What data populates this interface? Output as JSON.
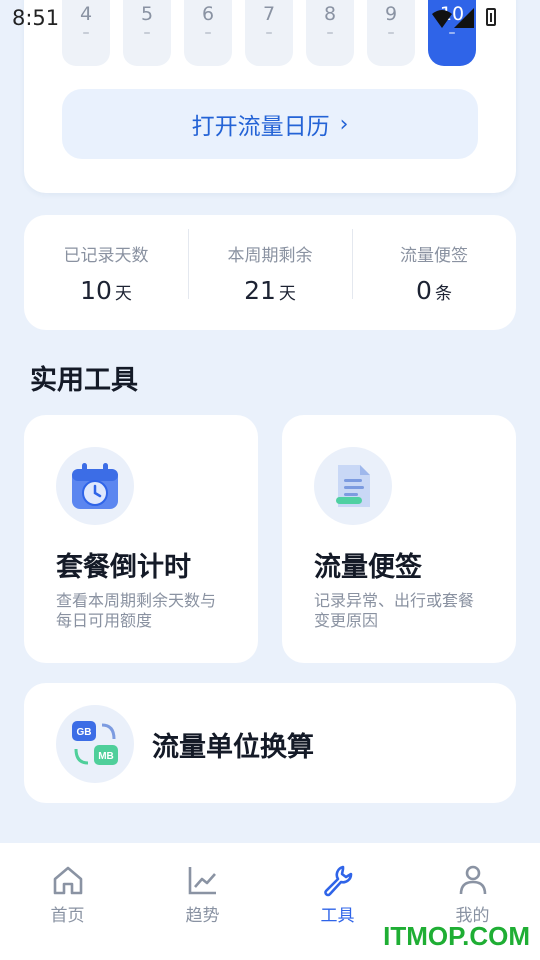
{
  "status_bar": {
    "time": "8:51"
  },
  "calendar": {
    "days": [
      {
        "num": "4",
        "value": "–",
        "active": false
      },
      {
        "num": "5",
        "value": "–",
        "active": false
      },
      {
        "num": "6",
        "value": "–",
        "active": false
      },
      {
        "num": "7",
        "value": "–",
        "active": false
      },
      {
        "num": "8",
        "value": "–",
        "active": false
      },
      {
        "num": "9",
        "value": "–",
        "active": false
      },
      {
        "num": "10",
        "value": "–",
        "active": true
      }
    ],
    "open_label": "打开流量日历",
    "open_chevron": "›"
  },
  "stats": [
    {
      "label": "已记录天数",
      "value": "10",
      "unit": "天"
    },
    {
      "label": "本周期剩余",
      "value": "21",
      "unit": "天"
    },
    {
      "label": "流量便签",
      "value": "0",
      "unit": "条"
    }
  ],
  "section": {
    "title": "实用工具"
  },
  "tools": {
    "countdown": {
      "title": "套餐倒计时",
      "desc": "查看本周期剩余天数与每日可用额度",
      "icon": "calendar-clock-icon"
    },
    "notes": {
      "title": "流量便签",
      "desc": "记录异常、出行或套餐变更原因",
      "icon": "note-icon"
    },
    "converter": {
      "title": "流量单位换算",
      "icon": "gb-mb-convert-icon",
      "badge_gb": "GB",
      "badge_mb": "MB"
    }
  },
  "nav": {
    "items": [
      {
        "label": "首页",
        "icon": "home-icon",
        "active": false
      },
      {
        "label": "趋势",
        "icon": "trend-icon",
        "active": false
      },
      {
        "label": "工具",
        "icon": "wrench-icon",
        "active": true
      },
      {
        "label": "我的",
        "icon": "person-icon",
        "active": false
      }
    ]
  },
  "watermark": "ITMOP.COM",
  "colors": {
    "accent": "#2f64e8",
    "background": "#eaf1fb",
    "card": "#ffffff"
  }
}
